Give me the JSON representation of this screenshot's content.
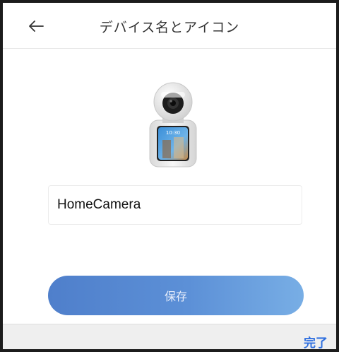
{
  "header": {
    "back_icon": "arrow-left-icon",
    "title": "デバイス名とアイコン"
  },
  "device": {
    "image": "camera-device-image",
    "screen_time": "10:30"
  },
  "name_input": {
    "value": "HomeCamera"
  },
  "save_button": {
    "label": "保存"
  },
  "keyboard_bar": {
    "done_label": "完了"
  },
  "colors": {
    "accent": "#2f6fdf",
    "button_start": "#4f7fcb",
    "button_end": "#78aee5"
  }
}
